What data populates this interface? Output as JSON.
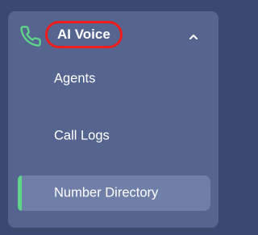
{
  "section": {
    "title": "AI Voice",
    "icon": "phone-icon",
    "toggle_icon": "chevron-up-icon",
    "accent_color": "#5fd58a",
    "highlight_color": "#ee1c1c"
  },
  "nav": {
    "items": [
      {
        "label": "Agents",
        "active": false
      },
      {
        "label": "Call Logs",
        "active": false
      },
      {
        "label": "Number Directory",
        "active": true
      }
    ]
  }
}
